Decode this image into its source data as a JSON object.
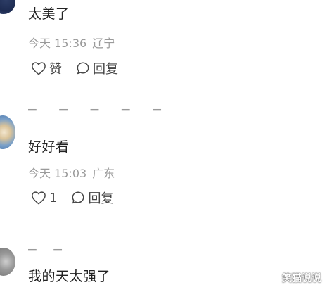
{
  "comments": [
    {
      "text": "太美了",
      "date": "今天 15:36",
      "location": "辽宁",
      "like_label": "赞",
      "reply_label": "回复"
    },
    {
      "text": "好好看",
      "date": "今天 15:03",
      "location": "广东",
      "like_label": "1",
      "reply_label": "回复"
    },
    {
      "text": "我的天太强了"
    }
  ],
  "watermark": "笑猫说说"
}
